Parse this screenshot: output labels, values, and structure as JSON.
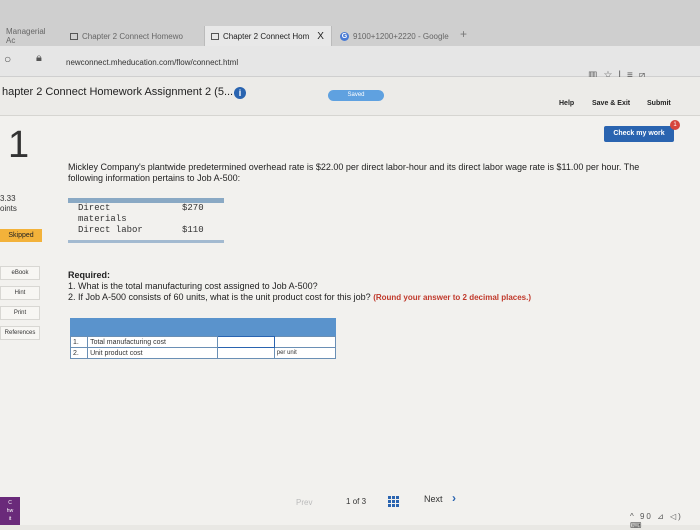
{
  "browser": {
    "tabs": [
      {
        "label": "Managerial Ac",
        "active": false
      },
      {
        "label": "Chapter 2 Connect Homewo",
        "active": false
      },
      {
        "label": "Chapter 2 Connect Hom",
        "active": true,
        "close": "X"
      },
      {
        "label": "9100+1200+2220 - Google",
        "active": false
      }
    ],
    "new_tab": "+",
    "url": "newconnect.mheducation.com/flow/connect.html"
  },
  "header": {
    "title": "hapter 2 Connect Homework Assignment 2 (5...",
    "info": "i",
    "saved": "Saved",
    "help": "Help",
    "save_exit": "Save & Exit",
    "submit": "Submit"
  },
  "check": {
    "label": "Check my work",
    "badge": "1"
  },
  "rail": {
    "question_number": "1",
    "points_value": "3.33",
    "points_label": "oints",
    "status": "Skipped",
    "ebook": "eBook",
    "hint": "Hint",
    "print": "Print",
    "references": "References"
  },
  "question": {
    "text": "Mickley Company's plantwide predetermined overhead rate is $22.00 per direct labor-hour and its direct labor wage rate is $11.00 per hour. The following information pertains to Job A-500:",
    "table": [
      {
        "label": "Direct materials",
        "value": "$270"
      },
      {
        "label": "Direct labor",
        "value": "$110"
      }
    ],
    "required_heading": "Required:",
    "req1": "1. What is the total manufacturing cost assigned to Job A-500?",
    "req2": "2. If Job A-500 consists of 60 units, what is the unit product cost for this job?",
    "req2_note": "(Round your answer to 2 decimal places.)"
  },
  "answer": {
    "rows": [
      {
        "num": "1.",
        "label": "Total manufacturing cost",
        "value": "",
        "unit": ""
      },
      {
        "num": "2.",
        "label": "Unit product cost",
        "value": "",
        "unit": "per unit"
      }
    ]
  },
  "nav": {
    "prev": "Prev",
    "page": "1",
    "of": "of",
    "total": "3",
    "next": "Next",
    "next_chevron": "›"
  },
  "taskbar": {
    "app": "C\nhw\nit",
    "tray": "^ 90 ⊿ ◁) ⌨"
  }
}
